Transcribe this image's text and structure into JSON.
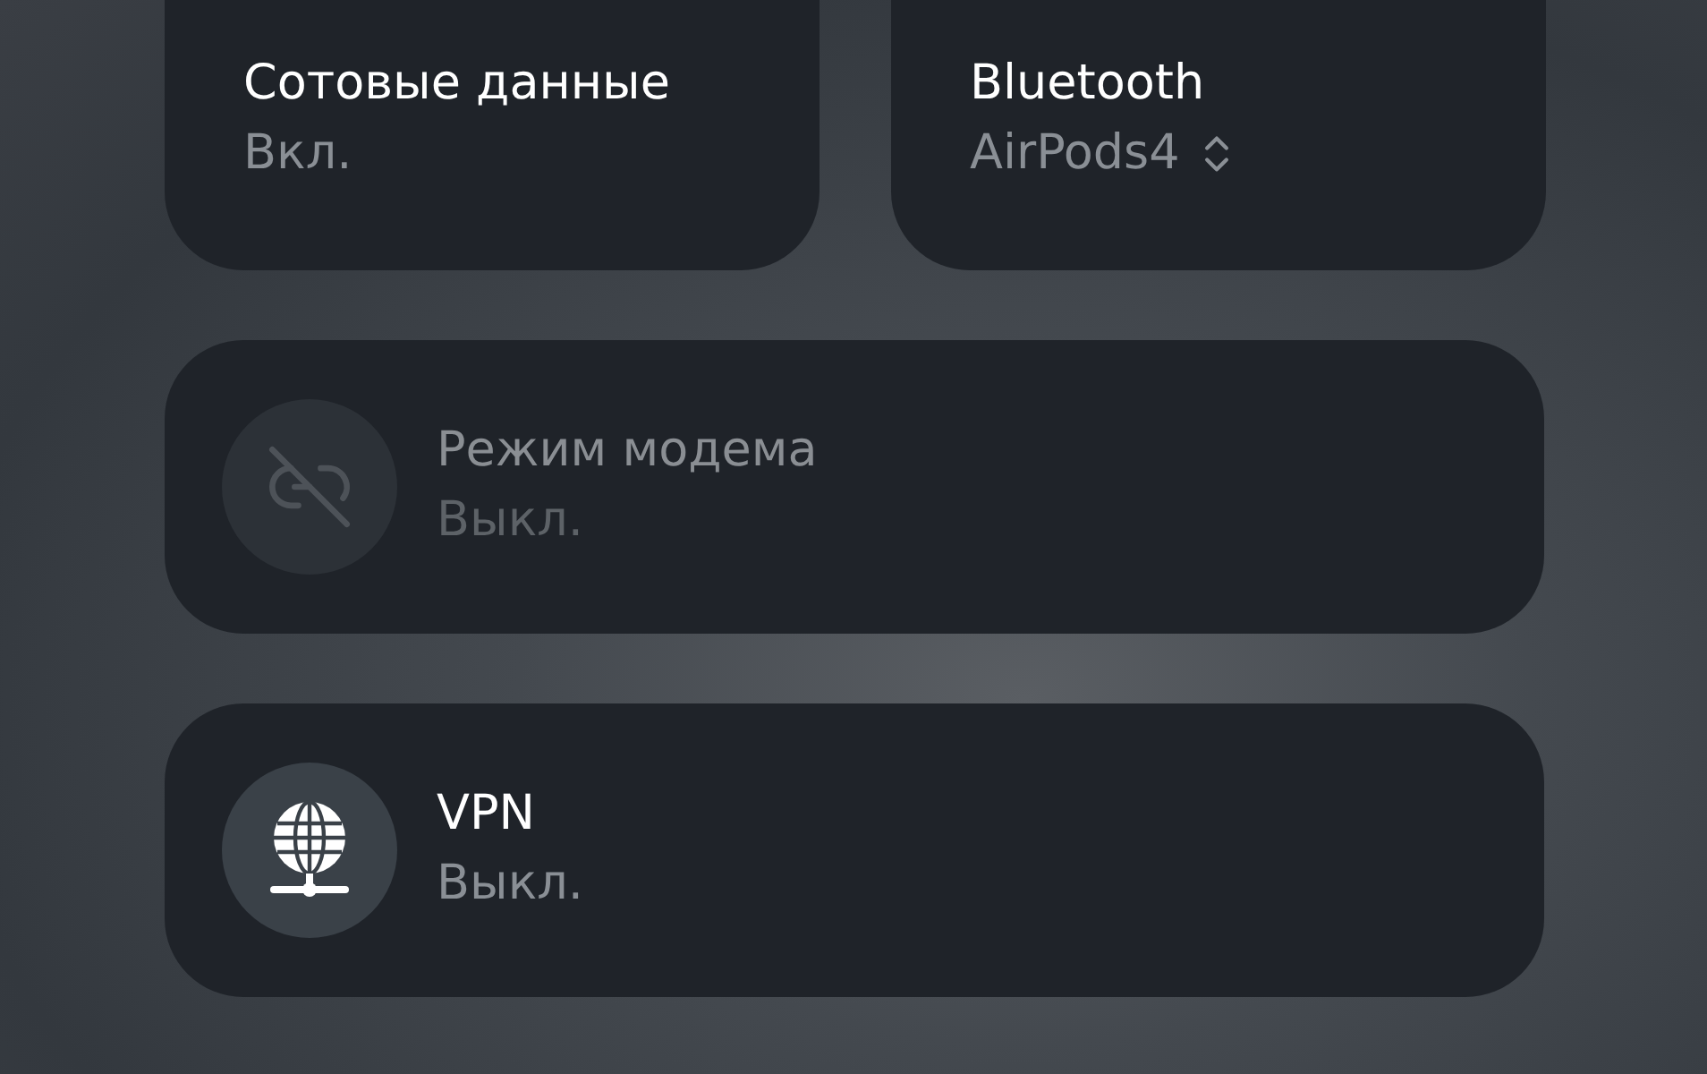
{
  "top_tiles": [
    {
      "title": "Сотовые данные",
      "subtitle": "Вкл.",
      "chooser": false
    },
    {
      "title": "Bluetooth",
      "subtitle": "AirPods4",
      "chooser": true
    }
  ],
  "wide_tiles": [
    {
      "title": "Режим модема",
      "subtitle": "Выкл.",
      "kind": "hotspot",
      "disabled": true
    },
    {
      "title": "VPN",
      "subtitle": "Выкл.",
      "kind": "vpn",
      "disabled": false
    }
  ]
}
